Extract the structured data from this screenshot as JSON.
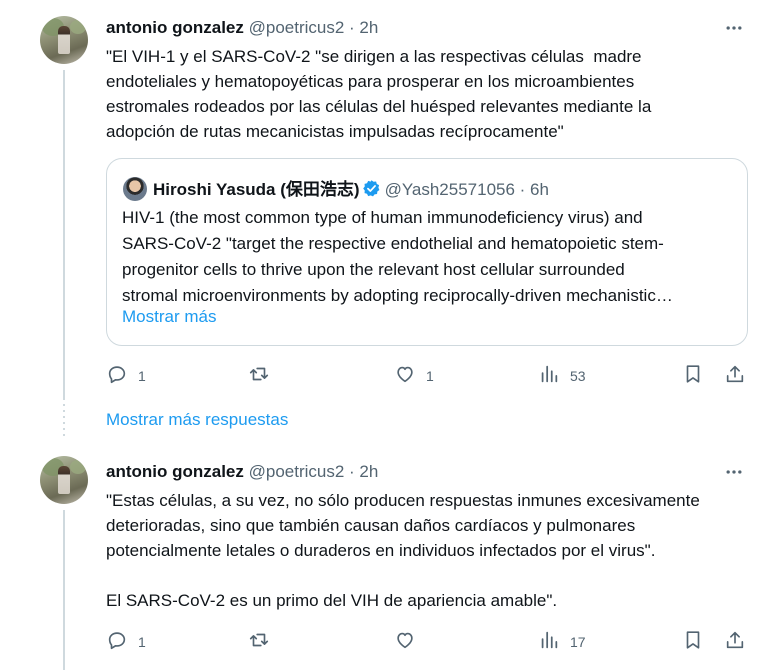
{
  "tweet1": {
    "name": "antonio gonzalez",
    "meta": "@poetricus2 · 2h",
    "text": "\"El VIH-1 y el SARS-CoV-2 \"se dirigen a las respectivas células  madre\nendoteliales y hematopoyéticas para prosperar en los microambientes\nestromales rodeados por las células del huésped relevantes mediante la\nadopción de rutas mecanicistas impulsadas recíprocamente\"",
    "quote": {
      "name": "Hiroshi Yasuda (保田浩志)",
      "meta": "@Yash25571056 · 6h",
      "text": "HIV-1 (the most common type of human immunodeficiency virus) and\nSARS-CoV-2 \"target the respective endothelial and hematopoietic stem-\nprogenitor cells to thrive upon the relevant host cellular surrounded\nstromal microenvironments by adopting reciprocally-driven mechanistic…",
      "show_more": "Mostrar más"
    },
    "actions": {
      "replies": "1",
      "retweets": "",
      "likes": "1",
      "views": "53"
    }
  },
  "show_more_replies": "Mostrar más respuestas",
  "tweet2": {
    "name": "antonio gonzalez",
    "meta": "@poetricus2 · 2h",
    "text": "\"Estas células, a su vez, no sólo producen respuestas inmunes excesivamente\ndeterioradas, sino que también causan daños cardíacos y pulmonares\npotencialmente letales o duraderos en individuos infectados por el virus\".\n\nEl SARS-CoV-2 es un primo del VIH de apariencia amable\".",
    "actions": {
      "replies": "1",
      "retweets": "",
      "likes": "",
      "views": "17"
    }
  },
  "icons": {
    "reply": "reply-icon",
    "retweet": "retweet-icon",
    "like": "heart-icon",
    "views": "views-icon",
    "bookmark": "bookmark-icon",
    "share": "share-icon",
    "more": "more-icon",
    "verified": "verified-badge-icon"
  },
  "colors": {
    "accent": "#1d9bf0",
    "muted": "#536471",
    "border": "#cfd9de",
    "text": "#0f1419"
  }
}
